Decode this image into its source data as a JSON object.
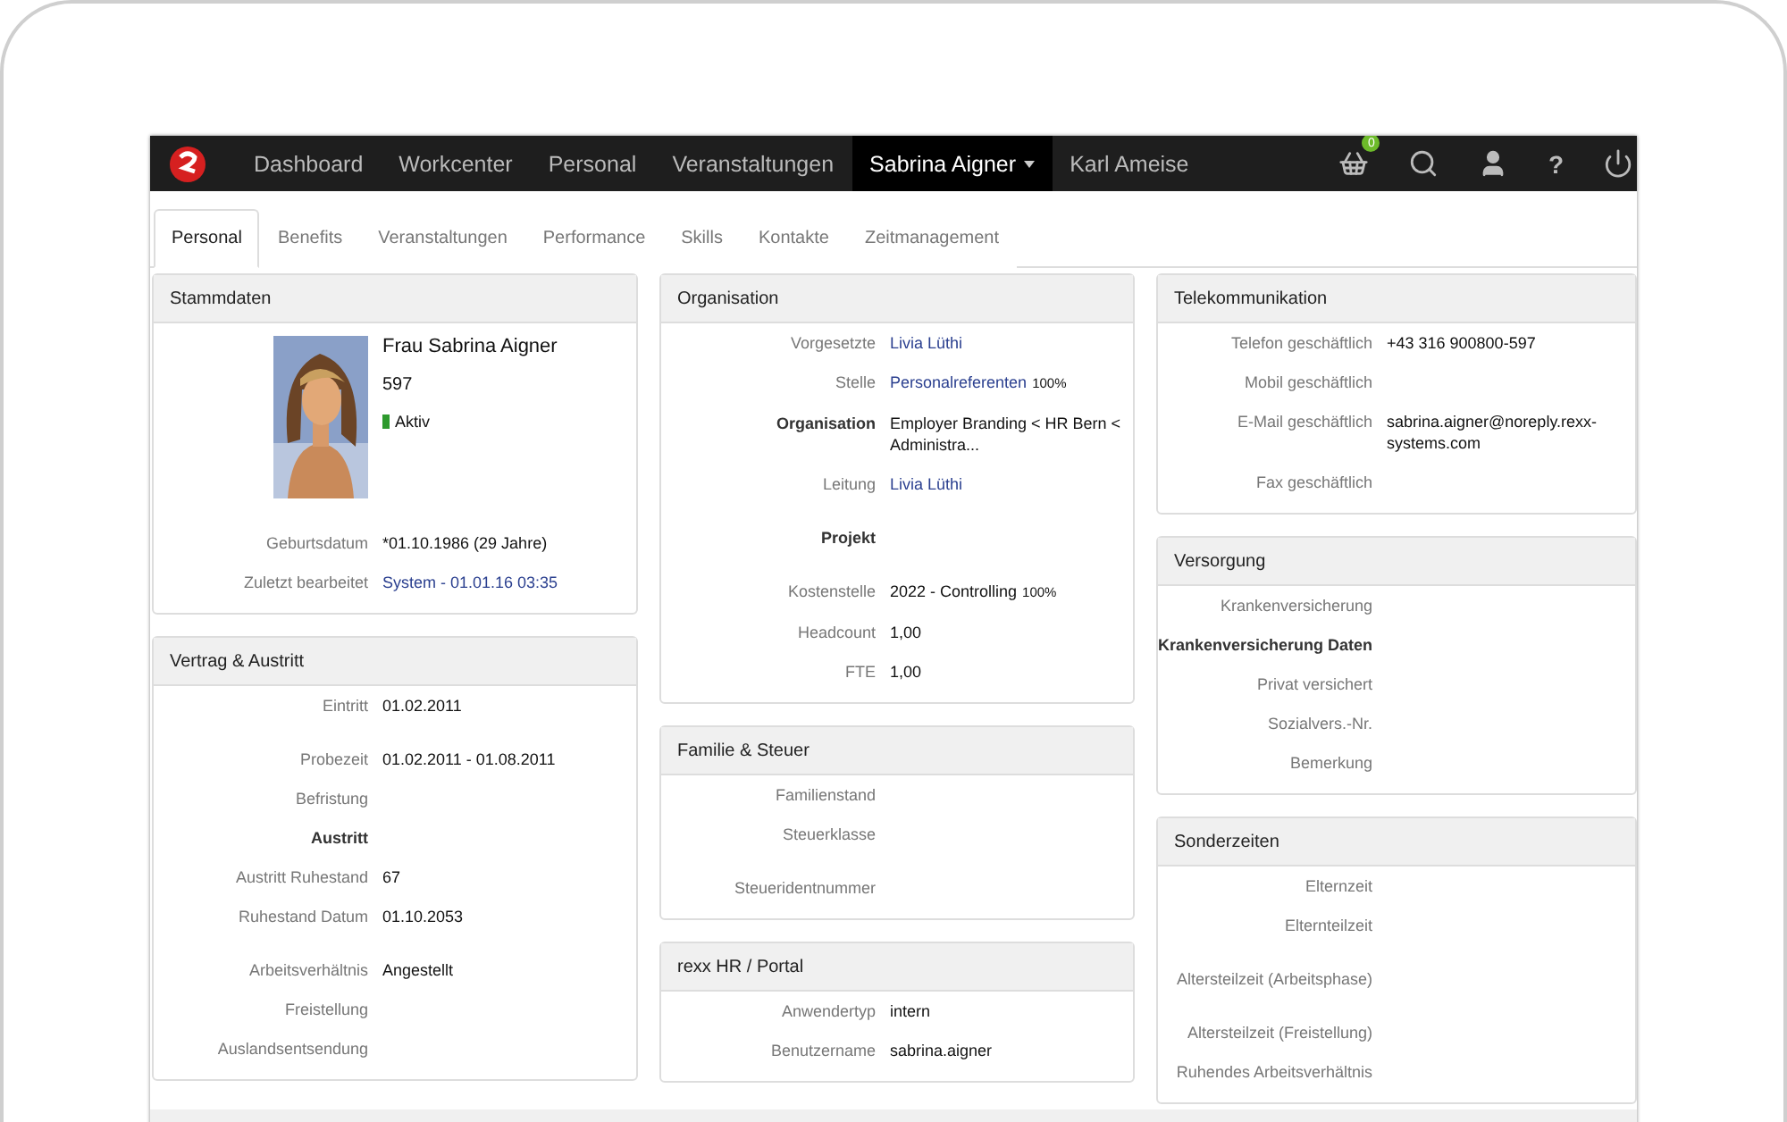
{
  "nav": {
    "items": [
      {
        "label": "Dashboard",
        "selected": false,
        "dropdown": false
      },
      {
        "label": "Workcenter",
        "selected": false,
        "dropdown": false
      },
      {
        "label": "Personal",
        "selected": false,
        "dropdown": false
      },
      {
        "label": "Veranstaltungen",
        "selected": false,
        "dropdown": false
      },
      {
        "label": "Sabrina Aigner",
        "selected": true,
        "dropdown": true
      },
      {
        "label": "Karl Ameise",
        "selected": false,
        "dropdown": false
      }
    ],
    "basket_badge": "0",
    "help": "?"
  },
  "tabs": [
    {
      "label": "Personal",
      "selected": true
    },
    {
      "label": "Benefits",
      "selected": false
    },
    {
      "label": "Veranstaltungen",
      "selected": false
    },
    {
      "label": "Performance",
      "selected": false
    },
    {
      "label": "Skills",
      "selected": false
    },
    {
      "label": "Kontakte",
      "selected": false
    },
    {
      "label": "Zeitmanagement",
      "selected": false
    }
  ],
  "profile": {
    "name": "Frau Sabrina Aigner",
    "number": "597",
    "status": {
      "label": "Aktiv",
      "color": "#2e9a2e"
    }
  },
  "columns": [
    [
      {
        "title": "Stammdaten",
        "profile": true,
        "rows": [
          {
            "label": "Geburtsdatum",
            "value": "*01.10.1986 (29 Jahre)"
          },
          {
            "label": "Zuletzt bearbeitet",
            "value": "System - 01.01.16 03:35",
            "link": true
          }
        ]
      },
      {
        "title": "Vertrag & Austritt",
        "rows": [
          {
            "label": "Eintritt",
            "value": "01.02.2011"
          },
          {
            "label": "Probezeit",
            "value": "01.02.2011 - 01.08.2011",
            "spaced": true
          },
          {
            "label": "Befristung"
          },
          {
            "label": "Austritt",
            "bold": true
          },
          {
            "label": "Austritt Ruhestand",
            "value": "67"
          },
          {
            "label": "Ruhestand Datum",
            "value": "01.10.2053"
          },
          {
            "label": "Arbeitsverhältnis",
            "value": "Angestellt",
            "spaced": true
          },
          {
            "label": "Freistellung"
          },
          {
            "label": "Auslandsentsendung"
          }
        ]
      }
    ],
    [
      {
        "title": "Organisation",
        "rows": [
          {
            "label": "Vorgesetzte",
            "value": "Livia Lüthi",
            "link": true
          },
          {
            "label": "Stelle",
            "value": "Personalreferenten",
            "link": true,
            "suffix": "100%"
          },
          {
            "label": "Organisation",
            "value": "Employer Branding < HR Bern < Administra...",
            "bold": true
          },
          {
            "label": "Leitung",
            "value": "Livia Lüthi",
            "link": true
          },
          {
            "label": "Projekt",
            "bold": true,
            "spaced": true
          },
          {
            "label": "Kostenstelle",
            "value": "2022 - Controlling",
            "suffix": "100%",
            "spaced": true
          },
          {
            "label": "Headcount",
            "value": "1,00"
          },
          {
            "label": "FTE",
            "value": "1,00"
          }
        ]
      },
      {
        "title": "Familie & Steuer",
        "rows": [
          {
            "label": "Familienstand"
          },
          {
            "label": "Steuerklasse"
          },
          {
            "label": "Steueridentnummer",
            "spaced": true
          }
        ]
      },
      {
        "title": "rexx HR / Portal",
        "rows": [
          {
            "label": "Anwendertyp",
            "value": "intern"
          },
          {
            "label": "Benutzername",
            "value": "sabrina.aigner"
          }
        ]
      }
    ],
    [
      {
        "title": "Telekommunikation",
        "rows": [
          {
            "label": "Telefon geschäftlich",
            "value": "+43 316 900800-597"
          },
          {
            "label": "Mobil geschäftlich"
          },
          {
            "label": "E-Mail geschäftlich",
            "value": "sabrina.aigner@noreply.rexx-systems.com"
          },
          {
            "label": "Fax geschäftlich"
          }
        ]
      },
      {
        "title": "Versorgung",
        "rows": [
          {
            "label": "Krankenversicherung"
          },
          {
            "label": "Krankenversicherung Daten",
            "bold": true
          },
          {
            "label": "Privat versichert"
          },
          {
            "label": "Sozialvers.-Nr."
          },
          {
            "label": "Bemerkung"
          }
        ]
      },
      {
        "title": "Sonderzeiten",
        "rows": [
          {
            "label": "Elternzeit"
          },
          {
            "label": "Elternteilzeit"
          },
          {
            "label": "Altersteilzeit (Arbeitsphase)",
            "spaced": true
          },
          {
            "label": "Altersteilzeit (Freistellung)",
            "spaced": true
          },
          {
            "label": "Ruhendes Arbeitsverhältnis"
          }
        ]
      }
    ]
  ]
}
